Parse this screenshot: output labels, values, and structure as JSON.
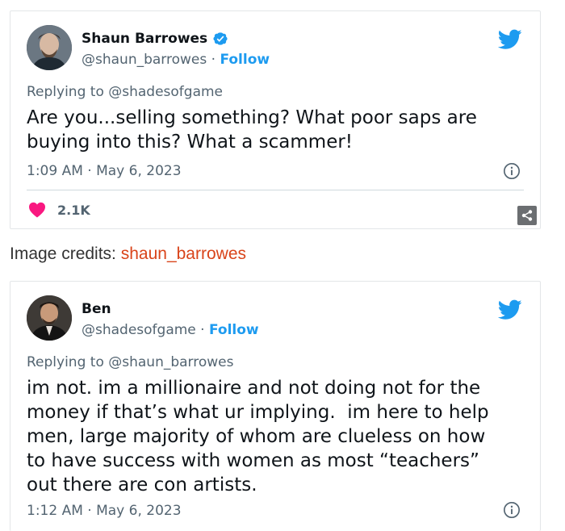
{
  "tweets": [
    {
      "name": "Shaun Barrowes",
      "handle": "@shaun_barrowes",
      "separator": " · ",
      "follow_label": "Follow",
      "replying_to": "Replying to @shadesofgame",
      "text": "Are you...selling something? What poor saps are\nbuying into this? What a scammer!",
      "timestamp": "1:09 AM · May 6, 2023",
      "likes": "2.1K",
      "verified": true,
      "avatar_icon": "profile-photo-icon"
    },
    {
      "name": "Ben",
      "handle": "@shadesofgame",
      "separator": " · ",
      "follow_label": "Follow",
      "replying_to": "Replying to @shaun_barrowes",
      "text": "im not. im a millionaire and not doing not for the\nmoney if that’s what ur implying.  im here to help\nmen, large majority of whom are clueless on how\nto have success with women as most “teachers”\nout there are con artists.",
      "timestamp": "1:12 AM · May 6, 2023",
      "verified": false,
      "avatar_icon": "profile-photo-icon"
    }
  ],
  "credits": {
    "label": "Image credits: ",
    "link": "shaun_barrowes"
  },
  "colors": {
    "twitter_blue": "#1d9bf0",
    "like_pink": "#f91880",
    "credit_link": "#d9441a"
  }
}
